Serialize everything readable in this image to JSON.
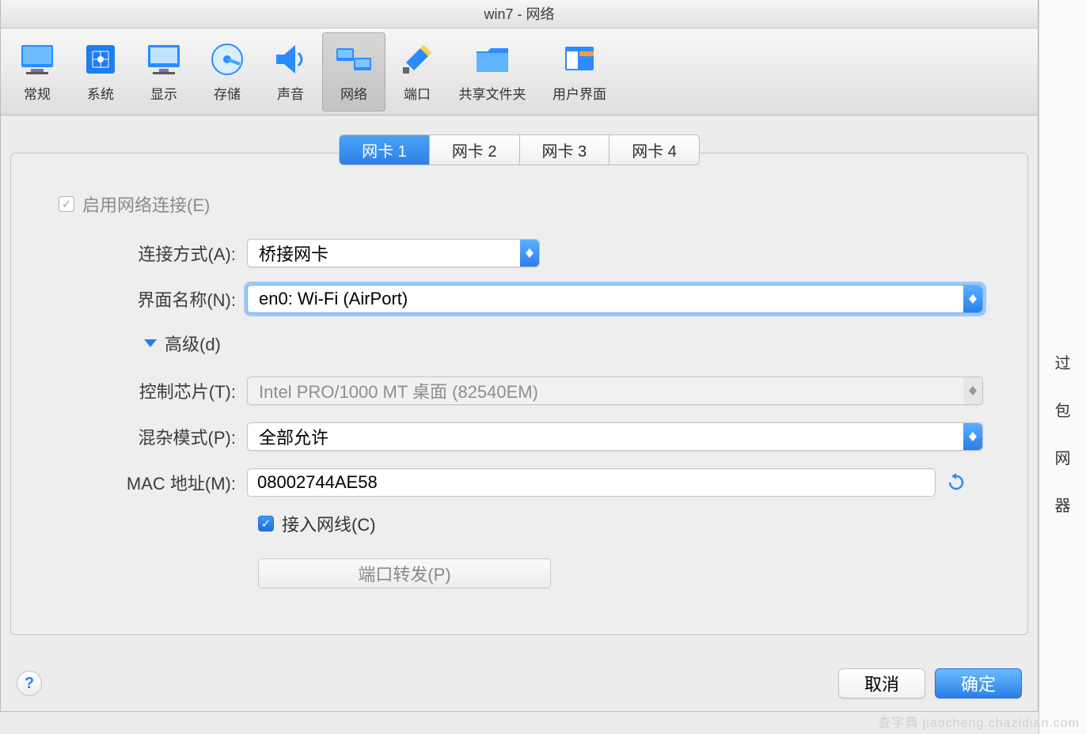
{
  "title": "win7 - 网络",
  "toolbar": [
    {
      "id": "general",
      "label": "常规"
    },
    {
      "id": "system",
      "label": "系统"
    },
    {
      "id": "display",
      "label": "显示"
    },
    {
      "id": "storage",
      "label": "存储"
    },
    {
      "id": "audio",
      "label": "声音"
    },
    {
      "id": "network",
      "label": "网络",
      "selected": true
    },
    {
      "id": "ports",
      "label": "端口"
    },
    {
      "id": "shared",
      "label": "共享文件夹",
      "wide": true
    },
    {
      "id": "ui",
      "label": "用户界面",
      "wide": true
    }
  ],
  "tabs": [
    "网卡 1",
    "网卡 2",
    "网卡 3",
    "网卡 4"
  ],
  "activeTab": 0,
  "enable": {
    "label": "启用网络连接(E)",
    "checked": true,
    "disabled": true
  },
  "form": {
    "attach_label": "连接方式(A):",
    "attach_value": "桥接网卡",
    "iface_label": "界面名称(N):",
    "iface_value": "en0: Wi-Fi (AirPort)",
    "adv_label": "高级(d)",
    "chip_label": "控制芯片(T):",
    "chip_value": "Intel PRO/1000 MT 桌面 (82540EM)",
    "promisc_label": "混杂模式(P):",
    "promisc_value": "全部允许",
    "mac_label": "MAC 地址(M):",
    "mac_value": "08002744AE58",
    "cable_label": "接入网线(C)",
    "portfwd_label": "端口转发(P)"
  },
  "footer": {
    "cancel": "取消",
    "ok": "确定"
  },
  "peek_chars": [
    "过",
    "包",
    "网",
    "器"
  ],
  "watermark": "查字典  jiaocheng.chazidian.com"
}
